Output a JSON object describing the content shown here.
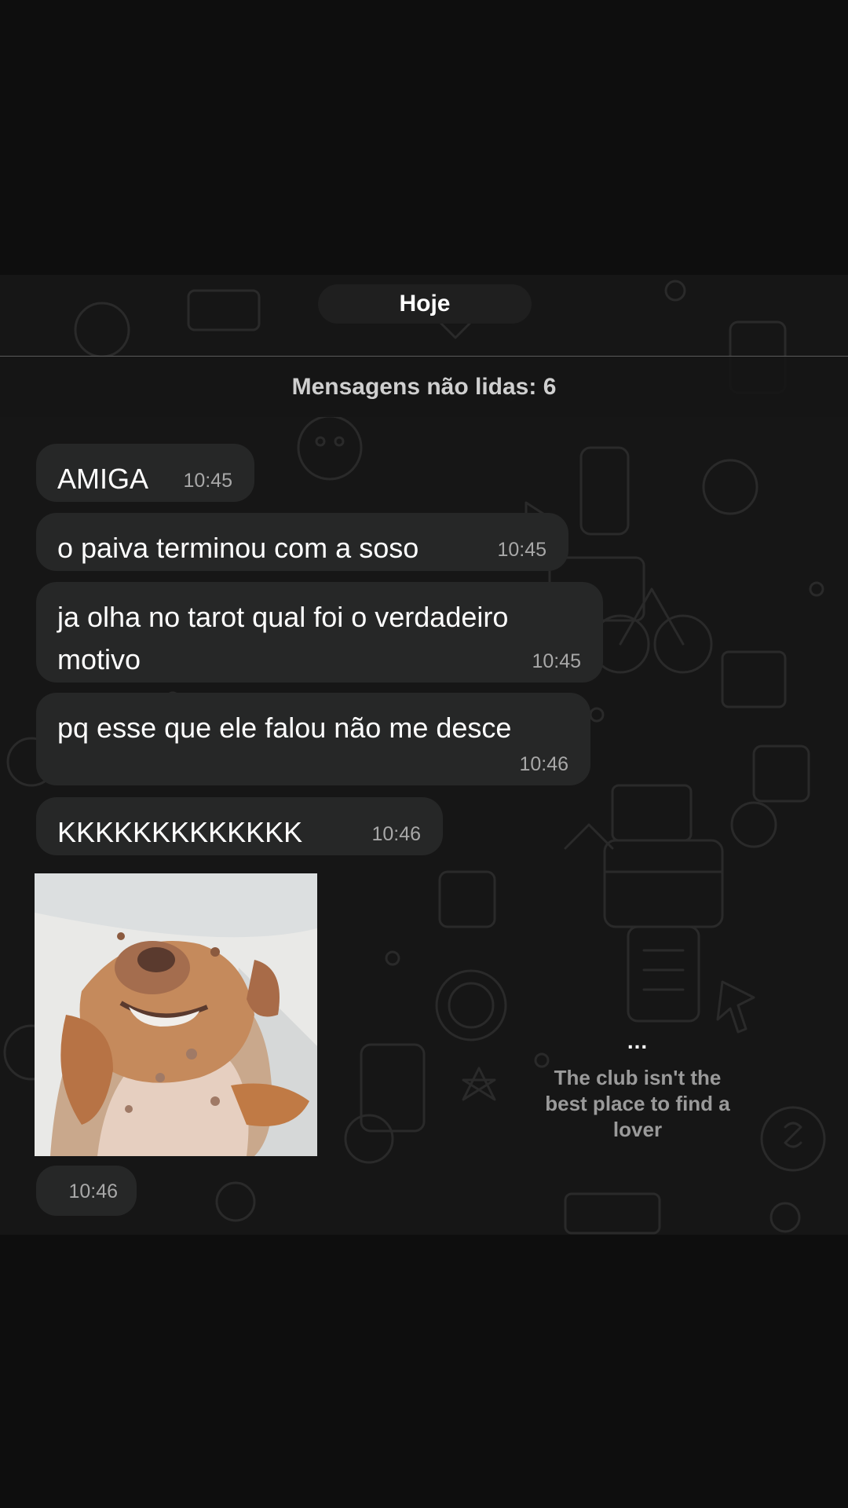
{
  "chat": {
    "day_chip": "Hoje",
    "unread_banner": "Mensagens não lidas: 6",
    "messages": [
      {
        "text": "AMIGA",
        "time": "10:45"
      },
      {
        "text": "o paiva terminou com a soso",
        "time": "10:45"
      },
      {
        "text": "ja olha no tarot qual foi o verdadeiro\nmotivo",
        "time": "10:45"
      },
      {
        "text": "pq esse que ele falou não me desce",
        "time": "10:46"
      },
      {
        "text": "KKKKKKKKKKKKK",
        "time": "10:46"
      }
    ],
    "photo_message": {
      "time": "10:46"
    }
  },
  "story_overlay": {
    "dots": "...",
    "caption": "The club isn't the best place to find a lover"
  },
  "colors": {
    "background": "#0e0e0e",
    "chat_background": "#161616",
    "bubble": "#262727",
    "timestamp": "#a8a8a8"
  }
}
